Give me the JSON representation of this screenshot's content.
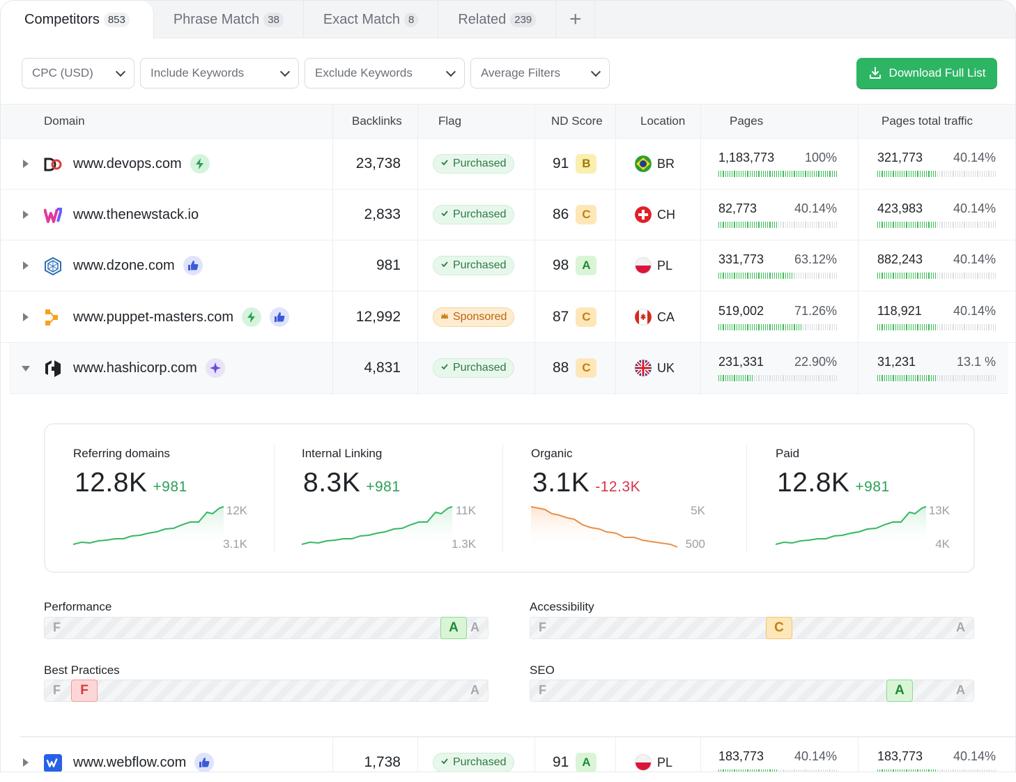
{
  "tabs": [
    {
      "label": "Competitors",
      "count": "853"
    },
    {
      "label": "Phrase Match",
      "count": "38"
    },
    {
      "label": "Exact Match",
      "count": "8"
    },
    {
      "label": "Related",
      "count": "239"
    }
  ],
  "tab_add_icon": "plus-icon",
  "filters": [
    {
      "label": "CPC (USD)"
    },
    {
      "label": "Include Keywords"
    },
    {
      "label": "Exclude Keywords"
    },
    {
      "label": "Average Filters"
    }
  ],
  "download_label": "Download Full List",
  "columns": {
    "domain": "Domain",
    "backlinks": "Backlinks",
    "flag": "Flag",
    "nd_score": "ND Score",
    "location": "Location",
    "pages": "Pages",
    "traffic": "Pages total traffic"
  },
  "rows": [
    {
      "domain": "www.devops.com",
      "badges": [
        "bolt-icon"
      ],
      "backlinks": "23,738",
      "flag": "Purchased",
      "score": "91",
      "grade": "B",
      "country": "BR",
      "pages": "1,183,773",
      "pages_pct": "100%",
      "pages_fill": 1.0,
      "traffic": "321,773",
      "traffic_pct": "40.14%",
      "traffic_fill": 0.5
    },
    {
      "domain": "www.thenewstack.io",
      "badges": [],
      "backlinks": "2,833",
      "flag": "Purchased",
      "score": "86",
      "grade": "C",
      "country": "CH",
      "pages": "82,773",
      "pages_pct": "40.14%",
      "pages_fill": 0.5,
      "traffic": "423,983",
      "traffic_pct": "40.14%",
      "traffic_fill": 0.5
    },
    {
      "domain": "www.dzone.com",
      "badges": [
        "thumbs-up-icon"
      ],
      "backlinks": "981",
      "flag": "Purchased",
      "score": "98",
      "grade": "A",
      "country": "PL",
      "pages": "331,773",
      "pages_pct": "63.12%",
      "pages_fill": 0.63,
      "traffic": "882,243",
      "traffic_pct": "40.14%",
      "traffic_fill": 0.5
    },
    {
      "domain": "www.puppet-masters.com",
      "badges": [
        "bolt-icon",
        "thumbs-up-icon"
      ],
      "backlinks": "12,992",
      "flag": "Sponsored",
      "score": "87",
      "grade": "C",
      "country": "CA",
      "pages": "519,002",
      "pages_pct": "71.26%",
      "pages_fill": 0.71,
      "traffic": "118,921",
      "traffic_pct": "40.14%",
      "traffic_fill": 0.5
    },
    {
      "domain": "www.hashicorp.com",
      "badges": [
        "sparkle-icon"
      ],
      "backlinks": "4,831",
      "flag": "Purchased",
      "score": "88",
      "grade": "C",
      "country": "UK",
      "pages": "231,331",
      "pages_pct": "22.90%",
      "pages_fill": 0.3,
      "traffic": "31,231",
      "traffic_pct": "13.1 %",
      "traffic_fill": 0.5
    },
    {
      "domain": "www.webflow.com",
      "badges": [
        "thumbs-up-icon"
      ],
      "backlinks": "1,738",
      "flag": "Purchased",
      "score": "91",
      "grade": "A",
      "country": "PL",
      "pages": "183,773",
      "pages_pct": "40.14%",
      "pages_fill": 0.5,
      "traffic": "183,773",
      "traffic_pct": "40.14%",
      "traffic_fill": 0.5
    }
  ],
  "stats": [
    {
      "label": "Referring domains",
      "value": "12.8K",
      "delta": "+981",
      "trend": "up",
      "axis_top": "12K",
      "axis_bottom": "3.1K"
    },
    {
      "label": "Internal Linking",
      "value": "8.3K",
      "delta": "+981",
      "trend": "up",
      "axis_top": "11K",
      "axis_bottom": "1.3K"
    },
    {
      "label": "Organic",
      "value": "3.1K",
      "delta": "-12.3K",
      "trend": "down",
      "axis_top": "5K",
      "axis_bottom": "500"
    },
    {
      "label": "Paid",
      "value": "12.8K",
      "delta": "+981",
      "trend": "up",
      "axis_top": "13K",
      "axis_bottom": "4K"
    }
  ],
  "audits": [
    {
      "label": "Performance",
      "grade": "A",
      "level": 0.92,
      "low": "F",
      "high": "A"
    },
    {
      "label": "Accessibility",
      "grade": "C",
      "level": 0.56,
      "low": "F",
      "high": "A"
    },
    {
      "label": "Best Practices",
      "grade": "F",
      "level": 0.09,
      "low": "F",
      "high": "A"
    },
    {
      "label": "SEO",
      "grade": "A",
      "level": 0.83,
      "low": "F",
      "high": "A"
    }
  ],
  "colors": {
    "accent": "#2db564",
    "up": "#2aa155",
    "down": "#d9324a",
    "bar_on": "#3bbd55"
  }
}
